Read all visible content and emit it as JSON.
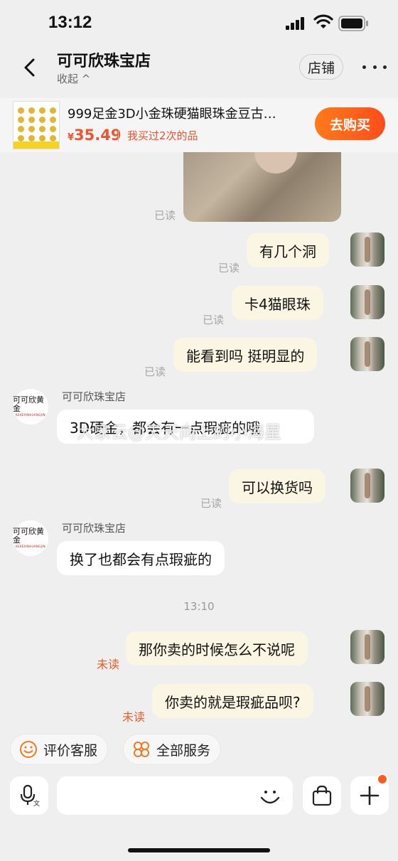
{
  "status_bar": {
    "time": "13:12"
  },
  "header": {
    "shop_name": "可可欣珠宝店",
    "collapse_label": "收起 ^",
    "store_button": "店铺"
  },
  "product": {
    "title": "999足金3D小金珠硬猫眼珠金豆古…",
    "currency": "¥",
    "price": "35.49",
    "note": "我买过2次的品",
    "buy_button": "去购买"
  },
  "messages": [
    {
      "kind": "image",
      "read_label": "已读"
    },
    {
      "kind": "out",
      "text": "有几个洞",
      "read_label": "已读"
    },
    {
      "kind": "out",
      "text": "卡4猫眼珠",
      "read_label": "已读"
    },
    {
      "kind": "out",
      "text": "能看到吗 挺明显的",
      "read_label": "已读"
    },
    {
      "kind": "in",
      "sender": "可可欣珠宝店",
      "text": "3D硬金，都会有一点瑕疵的哦"
    },
    {
      "kind": "out",
      "text": "可以换货吗",
      "read_label": "已读"
    },
    {
      "kind": "in",
      "sender": "可可欣珠宝店",
      "text": "换了也都会有点瑕疵的"
    },
    {
      "kind": "time",
      "text": "13:10"
    },
    {
      "kind": "out",
      "text": "那你卖的时候怎么不说呢",
      "read_label": "未读"
    },
    {
      "kind": "out",
      "text": "你卖的就是瑕疵品呗?",
      "read_label": "未读"
    }
  ],
  "shop_avatar": {
    "line1": "可可欣黄金",
    "line2": "KEKEXINHUANGJIN"
  },
  "watermark": "大家云@天天向上的小海星",
  "quick_actions": {
    "rate": "评价客服",
    "services": "全部服务"
  },
  "input": {
    "placeholder": ""
  },
  "icons": {
    "back": "chevron-left-icon",
    "more": "more-dots-icon",
    "voice": "microphone-icon",
    "emoji": "emoji-icon",
    "bag": "shopping-bag-icon",
    "plus": "plus-icon"
  },
  "colors": {
    "accent": "#ff5a1f",
    "price": "#f0542e",
    "bubble_out": "#fbf5e4",
    "bubble_in": "#ffffff"
  }
}
